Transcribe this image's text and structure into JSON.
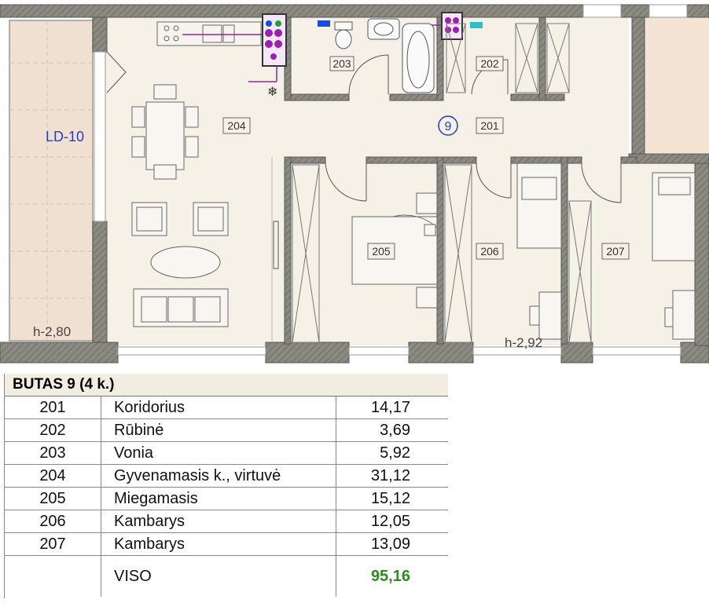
{
  "plan": {
    "rooms": [
      {
        "id": "201",
        "label": "201"
      },
      {
        "id": "202",
        "label": "202"
      },
      {
        "id": "203",
        "label": "203"
      },
      {
        "id": "204",
        "label": "204"
      },
      {
        "id": "205",
        "label": "205"
      },
      {
        "id": "206",
        "label": "206"
      },
      {
        "id": "207",
        "label": "207"
      }
    ],
    "apartment_marker": "9",
    "balcony_label": "LD-10",
    "height_left": "h-2,80",
    "height_main": "h-2,92",
    "colors": {
      "wall": "#8a8a80",
      "floor": "#f6f1e6",
      "balcony": "#f0e0d2",
      "marker": "#1f3fd0",
      "riser": "#8b2a9a"
    }
  },
  "legend": {
    "title": "BUTAS 9 (4 k.)",
    "rows": [
      {
        "id": "201",
        "name": "Koridorius",
        "area": "14,17"
      },
      {
        "id": "202",
        "name": "Rūbinė",
        "area": "3,69"
      },
      {
        "id": "203",
        "name": "Vonia",
        "area": "5,92"
      },
      {
        "id": "204",
        "name": "Gyvenamasis k., virtuvė",
        "area": "31,12"
      },
      {
        "id": "205",
        "name": "Miegamasis",
        "area": "15,12"
      },
      {
        "id": "206",
        "name": "Kambarys",
        "area": "12,05"
      },
      {
        "id": "207",
        "name": "Kambarys",
        "area": "13,09"
      }
    ],
    "total_label": "VISO",
    "total_area": "95,16"
  }
}
